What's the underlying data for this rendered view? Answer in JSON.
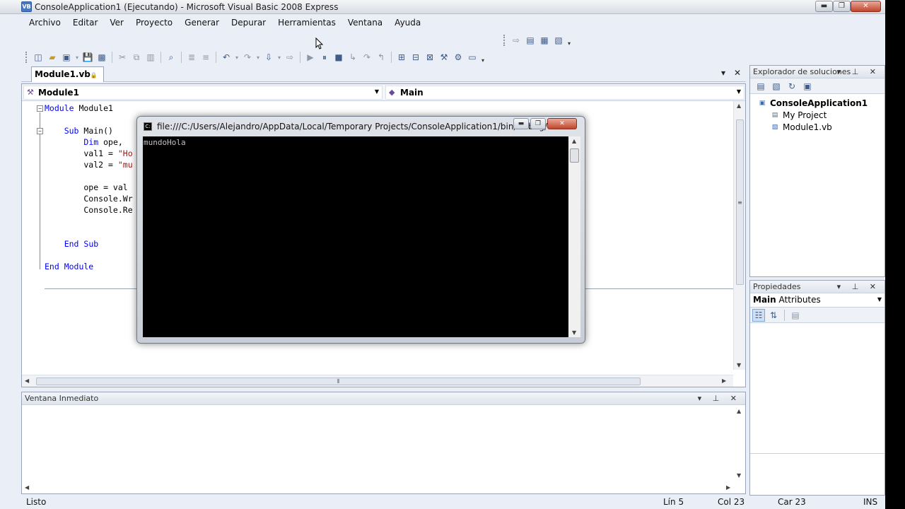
{
  "window": {
    "title": "ConsoleApplication1 (Ejecutando) - Microsoft Visual Basic 2008 Express",
    "app_icon": "vb-icon",
    "min_label": "▬",
    "max_label": "❐",
    "close_label": "✕"
  },
  "menu": [
    "Archivo",
    "Editar",
    "Ver",
    "Proyecto",
    "Generar",
    "Depurar",
    "Herramientas",
    "Ventana",
    "Ayuda"
  ],
  "doc_tab": {
    "label": "Module1.vb",
    "lock_glyph": "🔒",
    "dropdown_glyph": "▾",
    "close_glyph": "✕"
  },
  "editor": {
    "class_combo": "Module1",
    "method_combo": "Main",
    "code_lines": [
      [
        "kw:Module",
        " Module1"
      ],
      [],
      [
        "    ",
        "kw:Sub",
        " Main()"
      ],
      [
        "        ",
        "kw:Dim",
        " ope, "
      ],
      [
        "        val1 = ",
        "str:\"Ho"
      ],
      [
        "        val2 = ",
        "str:\"mu"
      ],
      [],
      [
        "        ope = val"
      ],
      [
        "        Console.Wr"
      ],
      [
        "        Console.Re"
      ],
      [],
      [],
      [
        "    ",
        "kw:End Sub"
      ],
      [],
      [
        "kw:End Module"
      ]
    ],
    "outline": [
      "−",
      "−"
    ]
  },
  "immediate": {
    "title": "Ventana Inmediato",
    "controls": "▾ ⊥ ✕"
  },
  "solution_explorer": {
    "title": "Explorador de soluciones",
    "controls": "▾ ⊥ ✕",
    "items": [
      {
        "label": "ConsoleApplication1",
        "bold": true,
        "icon": "project-icon"
      },
      {
        "label": "My Project",
        "bold": false,
        "icon": "my-project-icon"
      },
      {
        "label": "Module1.vb",
        "bold": false,
        "icon": "vb-file-icon"
      }
    ]
  },
  "properties": {
    "title": "Propiedades",
    "controls": "▾ ⊥ ✕",
    "object_name": "Main",
    "object_type": "Attributes"
  },
  "console": {
    "title": "file:///C:/Users/Alejandro/AppData/Local/Temporary Projects/ConsoleApplication1/bin/Debug/Co...",
    "output": "mundoHola",
    "min_label": "▬",
    "max_label": "❐",
    "close_label": "✕"
  },
  "status": {
    "text": "Listo",
    "line": "Lín 5",
    "col": "Col 23",
    "char": "Car 23",
    "mode": "INS"
  },
  "colors": {
    "keyword": "#0000ff",
    "string": "#a31515",
    "chrome": "#eaeef6"
  }
}
